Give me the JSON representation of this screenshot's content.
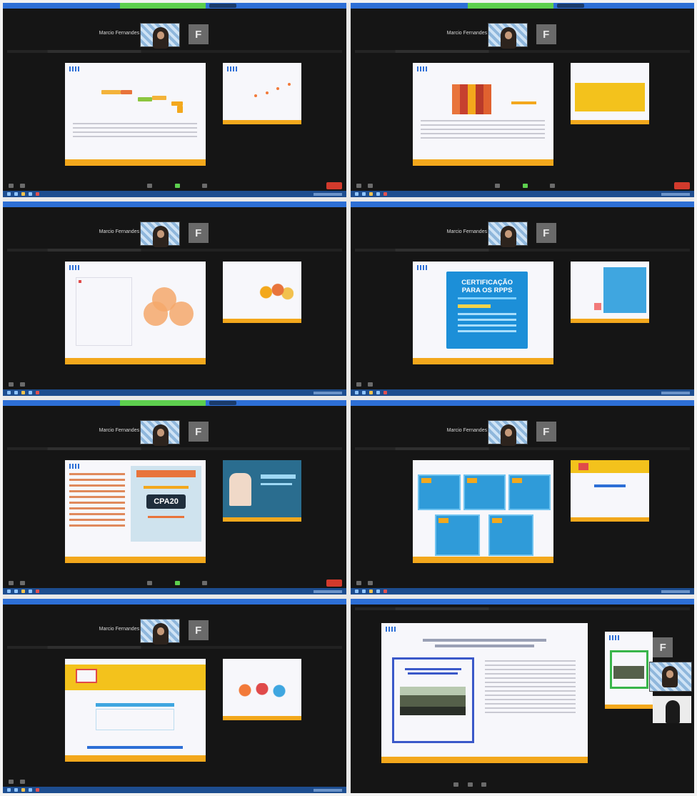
{
  "window": {
    "participant_name": "Marcio Fernandes",
    "avatar_letter": "F"
  },
  "panels": [
    {
      "id": "p1",
      "slide": "bar chart"
    },
    {
      "id": "p2",
      "slide": "column chart"
    },
    {
      "id": "p3",
      "slide": "venn diagram"
    },
    {
      "id": "p4",
      "slide": "certification",
      "cert_title_1": "CERTIFICAÇÃO",
      "cert_title_2": "PARA OS RPPS"
    },
    {
      "id": "p5",
      "slide": "cpa",
      "badge": "CPA20"
    },
    {
      "id": "p6",
      "slide": "tiles"
    },
    {
      "id": "p7",
      "slide": "yellow banner"
    },
    {
      "id": "p8",
      "slide": "report"
    }
  ],
  "colors": {
    "zoom_bg": "#151515",
    "zoom_blue": "#2d6fd6",
    "slide_orange": "#f3a81c",
    "leave_red": "#d23a2c",
    "cert_blue": "#1c8fd8"
  },
  "icons": [
    "camera-icon",
    "microphone-icon",
    "share-screen-icon",
    "leave-button"
  ]
}
